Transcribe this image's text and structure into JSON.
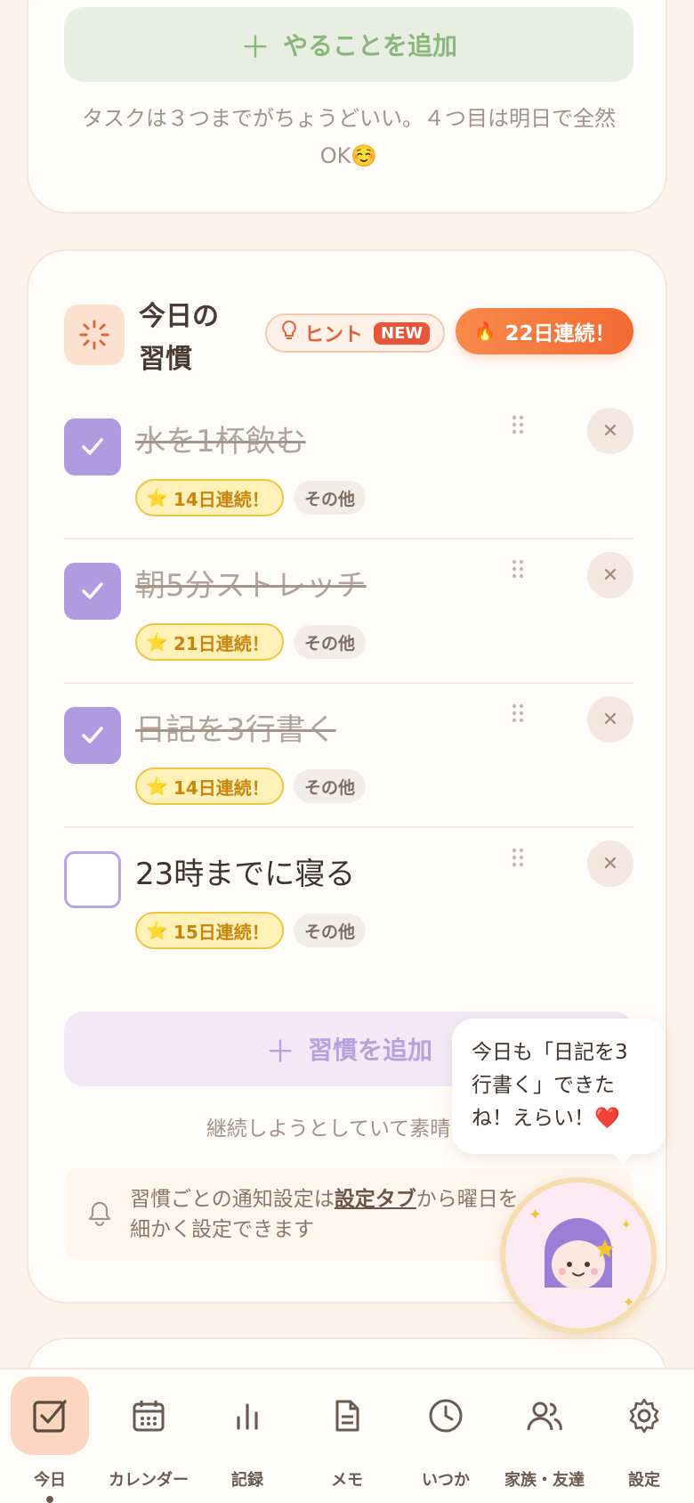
{
  "top_card": {
    "add_task_label": "やることを追加",
    "task_note_line1": "タスクは３つまでがちょうどいい。４つ目は明日で全然",
    "task_note_line2": "OK☺️"
  },
  "habits_card": {
    "title_line1": "今日の",
    "title_line2": "習慣",
    "hint_label": "ヒント",
    "new_badge": "NEW",
    "streak_total": "22日連続！",
    "habits": [
      {
        "name": "水を1杯飲む",
        "streak": "14日連続！",
        "category": "その他",
        "done": true
      },
      {
        "name": "朝5分ストレッチ",
        "streak": "21日連続！",
        "category": "その他",
        "done": true
      },
      {
        "name": "日記を3行書く",
        "streak": "14日連続！",
        "category": "その他",
        "done": true
      },
      {
        "name": "23時までに寝る",
        "streak": "15日連続！",
        "category": "その他",
        "done": false
      }
    ],
    "add_habit_label": "習慣を追加",
    "encourage_text": "継続しようとしていて素晴らし",
    "notif_prefix": "習慣ごとの通知設定は",
    "notif_link": "設定タブ",
    "notif_suffix": "から曜日を細かく設定できます"
  },
  "mascot": {
    "speech": "今日も「日記を3行書く」できたね！えらい！❤️"
  },
  "bottom_nav": [
    {
      "label": "今日",
      "icon": "check-square-icon",
      "active": true
    },
    {
      "label": "カレンダー",
      "icon": "calendar-icon",
      "active": false
    },
    {
      "label": "記録",
      "icon": "bar-chart-icon",
      "active": false
    },
    {
      "label": "メモ",
      "icon": "document-icon",
      "active": false
    },
    {
      "label": "いつか",
      "icon": "clock-icon",
      "active": false
    },
    {
      "label": "家族・友達",
      "icon": "people-icon",
      "active": false
    },
    {
      "label": "設定",
      "icon": "gear-icon",
      "active": false
    }
  ],
  "colors": {
    "accent_purple": "#b09be0",
    "streak_orange": "#f26a32",
    "add_task_green": "#8ab77c"
  }
}
